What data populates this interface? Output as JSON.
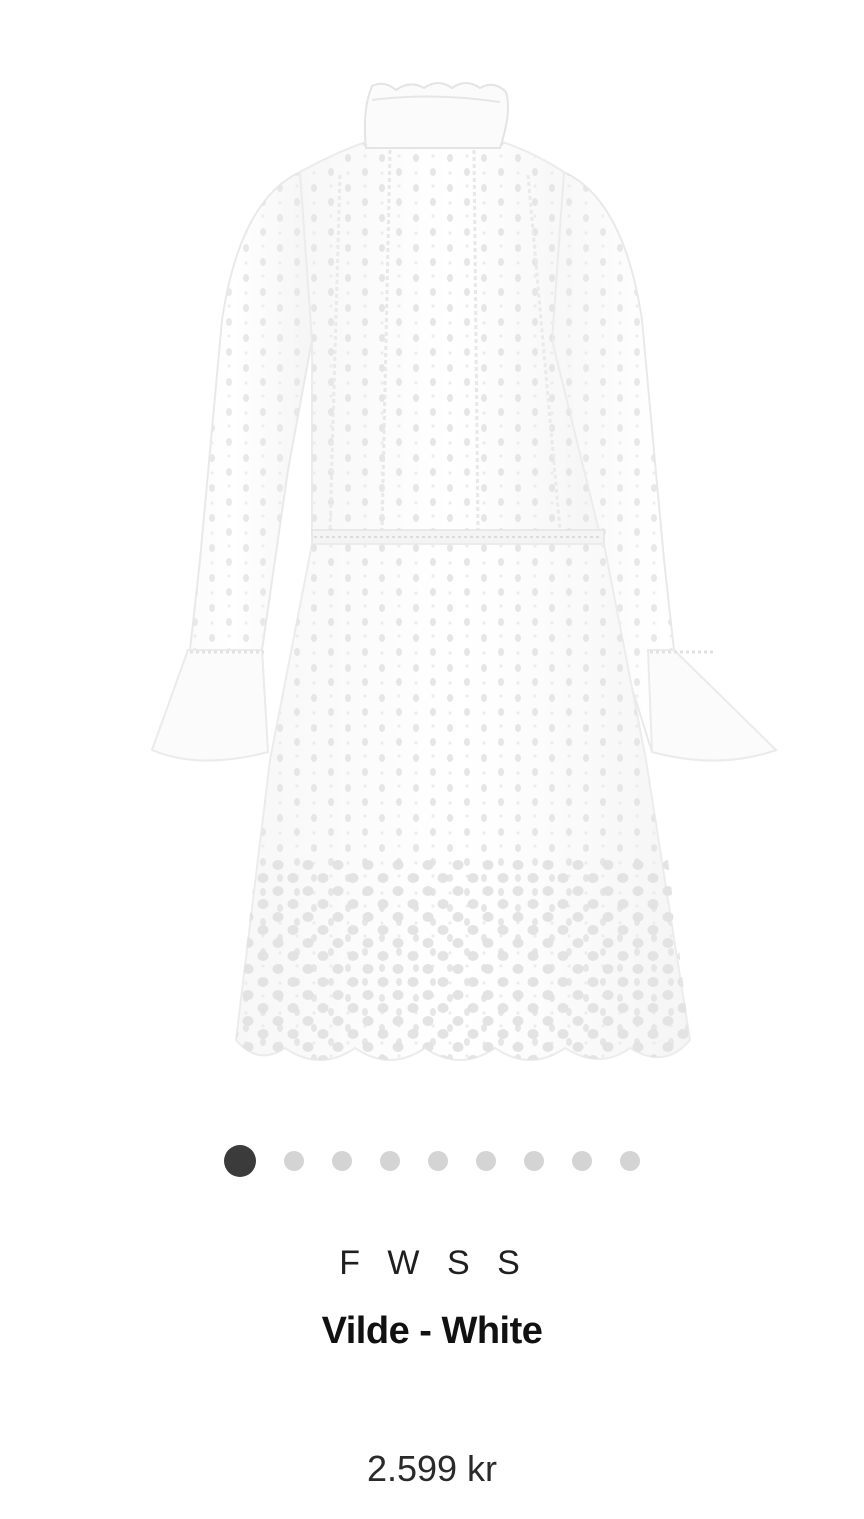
{
  "product": {
    "image_alt": "Vilde - White",
    "brand": "FWSS",
    "brand_display": "F W S S",
    "name": "Vilde - White",
    "price": "2.599 kr"
  },
  "carousel": {
    "total": 9,
    "active_index": 0,
    "colors": {
      "active": "#3b3b3b",
      "inactive": "#d4d4d4"
    }
  }
}
